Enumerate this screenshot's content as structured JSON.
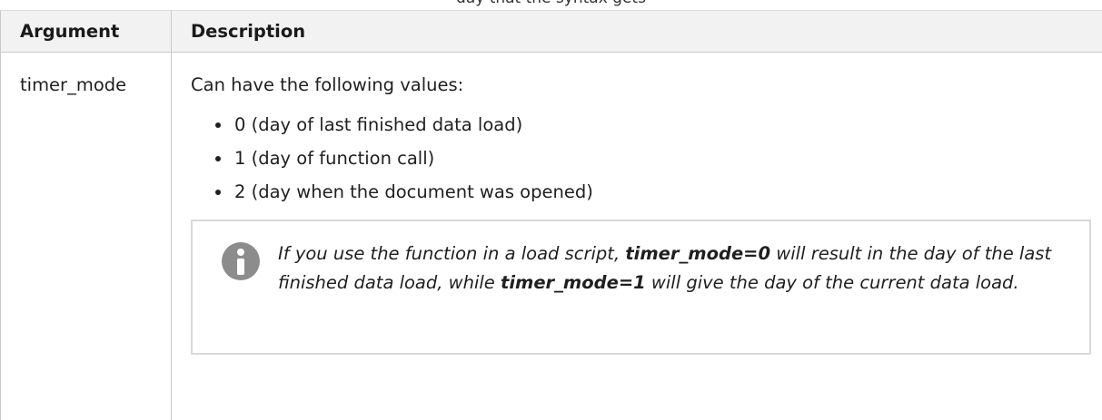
{
  "caption": {
    "fragment": "day that the syntax gets"
  },
  "table": {
    "headers": {
      "argument": "Argument",
      "description": "Description"
    },
    "row": {
      "argument": "timer_mode",
      "intro": "Can have the following values:",
      "values": [
        "0 (day of last finished data load)",
        "1 (day of function call)",
        "2 (day when the document was opened)"
      ],
      "note": {
        "icon": "info-icon",
        "text_1": "If you use the function in a load script, ",
        "bold_1": "timer_mode=0",
        "text_2": " will result in the day of the last finished data load, while ",
        "bold_2": "timer_mode=1",
        "text_3": " will give the day of the current data load."
      }
    }
  },
  "colors": {
    "header_bg": "#f2f2f2",
    "border": "#c8c8c8",
    "icon_gray": "#8c8c8c"
  }
}
